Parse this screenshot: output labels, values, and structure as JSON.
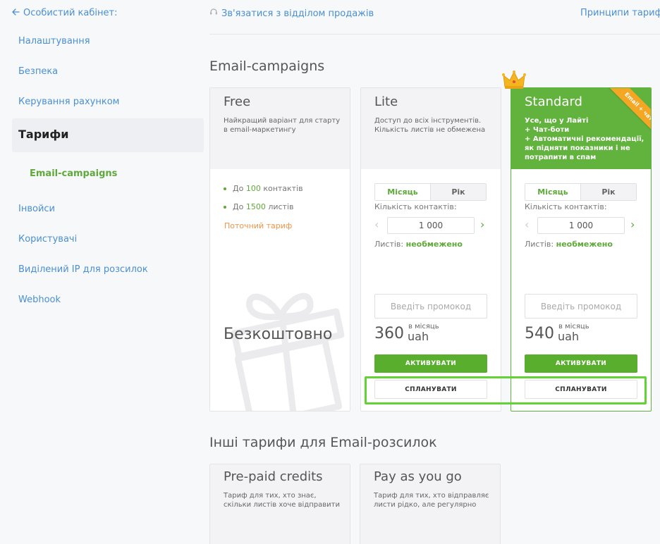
{
  "sidebar": {
    "back_label": "Особистий кабінет:",
    "items": [
      {
        "label": "Налаштування"
      },
      {
        "label": "Безпека"
      },
      {
        "label": "Керування рахунком"
      },
      {
        "label": "Тарифи"
      },
      {
        "label": "Email-campaigns"
      },
      {
        "label": "Інвойси"
      },
      {
        "label": "Користувачі"
      },
      {
        "label": "Виділений IP для розсилок"
      },
      {
        "label": "Webhook"
      }
    ]
  },
  "header": {
    "contact_sales": "Зв'язатися з відділом продажів",
    "principles": "Принципи тариф"
  },
  "main": {
    "section_title": "Email-campaigns",
    "other_title": "Інші тарифи для Email-розсилок",
    "plans": [
      {
        "name": "Free",
        "description": "Найкращий варіант для старту в email-маркетингу",
        "features": [
          {
            "prefix": "До",
            "value": "100",
            "suffix": "контактів"
          },
          {
            "prefix": "До",
            "value": "1500",
            "suffix": "листів"
          }
        ],
        "current_plan": "Поточний тариф",
        "price_text": "Безкоштовно"
      },
      {
        "name": "Lite",
        "description": "Доступ до всіх інструментів. Кількість листів не обмежена",
        "period_month": "Місяць",
        "period_year": "Рік",
        "contacts_label": "Кількість контактів:",
        "contacts_value": "1 000",
        "letters_label": "Листів:",
        "letters_value": "необмежено",
        "promo_placeholder": "Введіть промокод",
        "price": "360",
        "per_month": "в місяць",
        "currency": "uah",
        "activate_label": "АКТИВУВАТИ",
        "plan_label": "СПЛАНУВАТИ"
      },
      {
        "name": "Standard",
        "description": "Усе, що у Лайті\n+ Чат-боти\n+ Автоматичні рекомендації, як підняти показники і не потрапити в спам",
        "ribbon": "Email + чатботи",
        "period_month": "Місяць",
        "period_year": "Рік",
        "contacts_label": "Кількість контактів:",
        "contacts_value": "1 000",
        "letters_label": "Листів:",
        "letters_value": "необмежено",
        "promo_placeholder": "Введіть промокод",
        "price": "540",
        "per_month": "в місяць",
        "currency": "uah",
        "activate_label": "АКТИВУВАТИ",
        "plan_label": "СПЛАНУВАТИ"
      }
    ],
    "other_plans": [
      {
        "name": "Pre-paid credits",
        "description": "Тариф для тих, хто знає, скільки листів хоче відправити"
      },
      {
        "name": "Pay as you go",
        "description": "Тариф для тих, хто відправляє листи рідко, але регулярно"
      }
    ]
  },
  "colors": {
    "accent_green": "#5fa93b",
    "link_blue": "#4a8fd3",
    "ribbon_orange": "#f5a623",
    "highlight_green": "#63d234"
  }
}
